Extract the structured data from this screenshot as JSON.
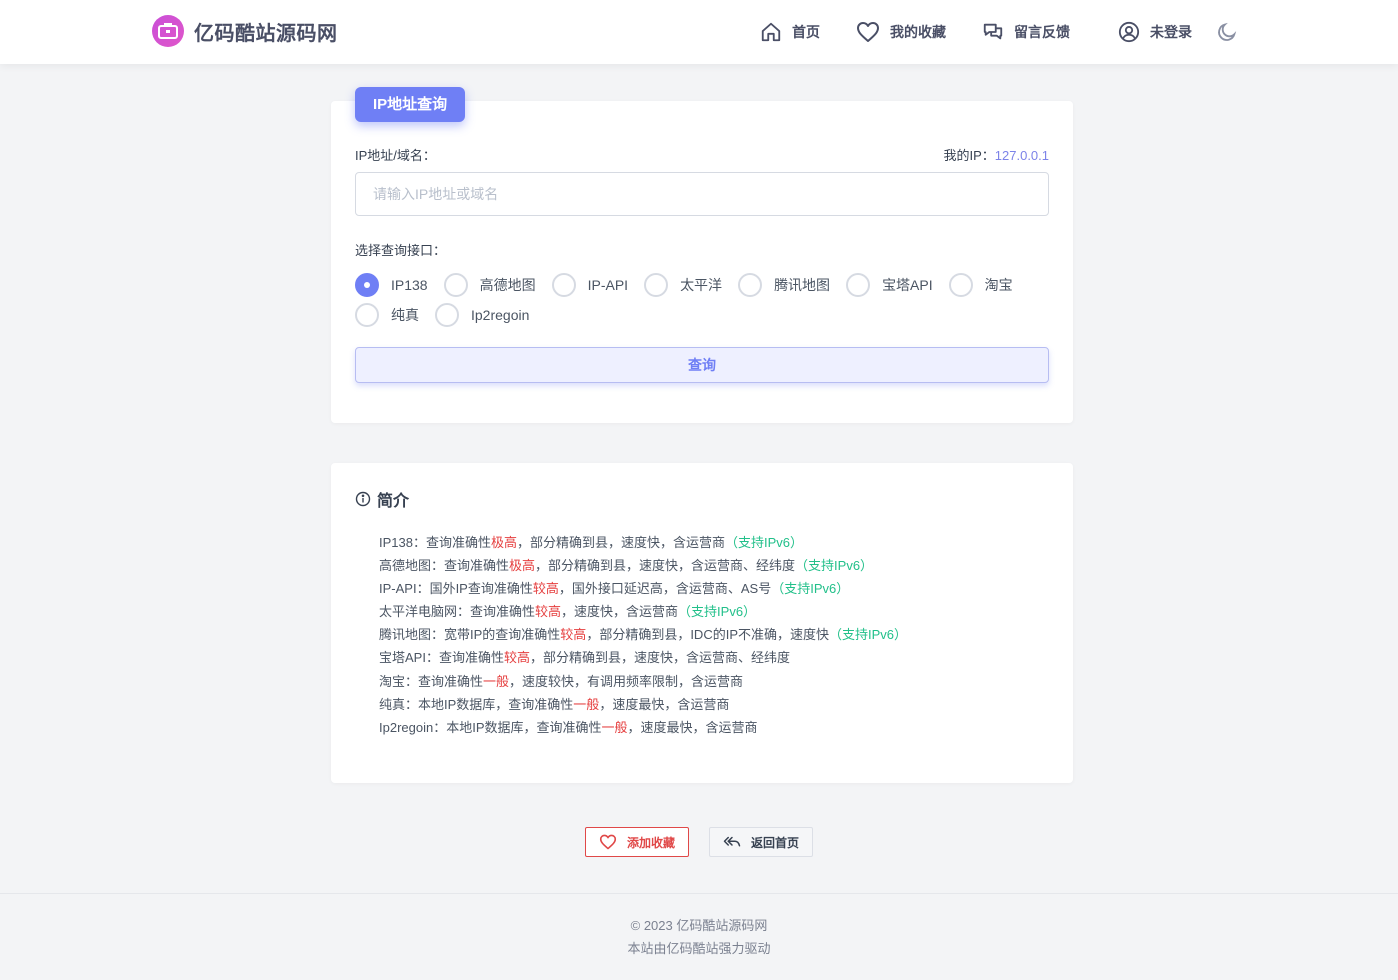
{
  "header": {
    "brand_name": "亿码酷站源码网",
    "nav": [
      {
        "label": "首页",
        "icon": "home-icon"
      },
      {
        "label": "我的收藏",
        "icon": "heart-icon"
      },
      {
        "label": "留言反馈",
        "icon": "chat-icon"
      },
      {
        "label": "未登录",
        "icon": "user-circle-icon"
      }
    ],
    "theme_icon": "moon-icon"
  },
  "query_card": {
    "badge": "IP地址查询",
    "field_label": "IP地址/域名：",
    "my_ip_label": "我的IP：",
    "my_ip_value": "127.0.0.1",
    "input_placeholder": "请输入IP地址或域名",
    "input_value": "",
    "api_label": "选择查询接口：",
    "apis": [
      "IP138",
      "高德地图",
      "IP-API",
      "太平洋",
      "腾讯地图",
      "宝塔API",
      "淘宝",
      "纯真",
      "Ip2regoin"
    ],
    "selected_api": "IP138",
    "query_button": "查询"
  },
  "intro_card": {
    "title": "简介",
    "lines": [
      {
        "name": "IP138",
        "pre": "IP138：查询准确性",
        "level": "极高",
        "post": "，部分精确到县，速度快，含运营商",
        "tag": "（支持IPv6）"
      },
      {
        "name": "高德地图",
        "pre": "高德地图：查询准确性",
        "level": "极高",
        "post": "，部分精确到县，速度快，含运营商、经纬度",
        "tag": "（支持IPv6）"
      },
      {
        "name": "IP-API",
        "pre": "IP-API：国外IP查询准确性",
        "level": "较高",
        "post": "，国外接口延迟高，含运营商、AS号",
        "tag": "（支持IPv6）"
      },
      {
        "name": "太平洋电脑网",
        "pre": "太平洋电脑网：查询准确性",
        "level": "较高",
        "post": "，速度快，含运营商",
        "tag": "（支持IPv6）"
      },
      {
        "name": "腾讯地图",
        "pre": "腾讯地图：宽带IP的查询准确性",
        "level": "较高",
        "post": "，部分精确到县，IDC的IP不准确，速度快",
        "tag": "（支持IPv6）"
      },
      {
        "name": "宝塔API",
        "pre": "宝塔API：查询准确性",
        "level": "较高",
        "post": "，部分精确到县，速度快，含运营商、经纬度",
        "tag": ""
      },
      {
        "name": "淘宝",
        "pre": "淘宝：查询准确性",
        "level": "一般",
        "post": "，速度较快，有调用频率限制，含运营商",
        "tag": ""
      },
      {
        "name": "纯真",
        "pre": "纯真：本地IP数据库，查询准确性",
        "level": "一般",
        "post": "，速度最快，含运营商",
        "tag": ""
      },
      {
        "name": "Ip2regoin",
        "pre": "Ip2regoin：本地IP数据库，查询准确性",
        "level": "一般",
        "post": "，速度最快，含运营商",
        "tag": ""
      }
    ]
  },
  "actions": {
    "favorite": "添加收藏",
    "back_home": "返回首页"
  },
  "footer": {
    "copyright": "© 2023 亿码酷站源码网",
    "powered": "本站由亿码酷站强力驱动"
  },
  "colors": {
    "accent": "#6f7ff5",
    "high_level": "#e53e3e",
    "ipv6_tag": "#22c08a"
  }
}
